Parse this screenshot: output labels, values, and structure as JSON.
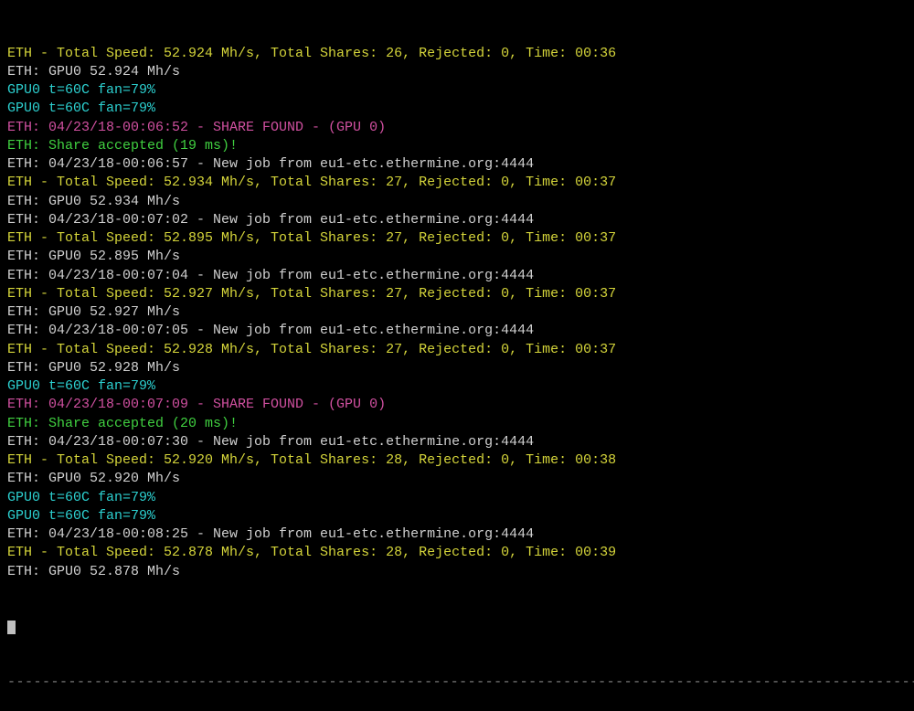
{
  "lines": [
    {
      "color": "yellow",
      "text": "ETH - Total Speed: 52.924 Mh/s, Total Shares: 26, Rejected: 0, Time: 00:36"
    },
    {
      "color": "white",
      "text": "ETH: GPU0 52.924 Mh/s"
    },
    {
      "color": "cyan",
      "text": "GPU0 t=60C fan=79%"
    },
    {
      "color": "cyan",
      "text": "GPU0 t=60C fan=79%"
    },
    {
      "color": "magenta",
      "text": "ETH: 04/23/18-00:06:52 - SHARE FOUND - (GPU 0)"
    },
    {
      "color": "green",
      "text": "ETH: Share accepted (19 ms)!"
    },
    {
      "color": "white",
      "text": "ETH: 04/23/18-00:06:57 - New job from eu1-etc.ethermine.org:4444"
    },
    {
      "color": "yellow",
      "text": "ETH - Total Speed: 52.934 Mh/s, Total Shares: 27, Rejected: 0, Time: 00:37"
    },
    {
      "color": "white",
      "text": "ETH: GPU0 52.934 Mh/s"
    },
    {
      "color": "white",
      "text": "ETH: 04/23/18-00:07:02 - New job from eu1-etc.ethermine.org:4444"
    },
    {
      "color": "yellow",
      "text": "ETH - Total Speed: 52.895 Mh/s, Total Shares: 27, Rejected: 0, Time: 00:37"
    },
    {
      "color": "white",
      "text": "ETH: GPU0 52.895 Mh/s"
    },
    {
      "color": "white",
      "text": "ETH: 04/23/18-00:07:04 - New job from eu1-etc.ethermine.org:4444"
    },
    {
      "color": "yellow",
      "text": "ETH - Total Speed: 52.927 Mh/s, Total Shares: 27, Rejected: 0, Time: 00:37"
    },
    {
      "color": "white",
      "text": "ETH: GPU0 52.927 Mh/s"
    },
    {
      "color": "white",
      "text": "ETH: 04/23/18-00:07:05 - New job from eu1-etc.ethermine.org:4444"
    },
    {
      "color": "yellow",
      "text": "ETH - Total Speed: 52.928 Mh/s, Total Shares: 27, Rejected: 0, Time: 00:37"
    },
    {
      "color": "white",
      "text": "ETH: GPU0 52.928 Mh/s"
    },
    {
      "color": "cyan",
      "text": "GPU0 t=60C fan=79%"
    },
    {
      "color": "magenta",
      "text": "ETH: 04/23/18-00:07:09 - SHARE FOUND - (GPU 0)"
    },
    {
      "color": "green",
      "text": "ETH: Share accepted (20 ms)!"
    },
    {
      "color": "white",
      "text": "ETH: 04/23/18-00:07:30 - New job from eu1-etc.ethermine.org:4444"
    },
    {
      "color": "yellow",
      "text": "ETH - Total Speed: 52.920 Mh/s, Total Shares: 28, Rejected: 0, Time: 00:38"
    },
    {
      "color": "white",
      "text": "ETH: GPU0 52.920 Mh/s"
    },
    {
      "color": "cyan",
      "text": "GPU0 t=60C fan=79%"
    },
    {
      "color": "cyan",
      "text": "GPU0 t=60C fan=79%"
    },
    {
      "color": "white",
      "text": "ETH: 04/23/18-00:08:25 - New job from eu1-etc.ethermine.org:4444"
    },
    {
      "color": "yellow",
      "text": "ETH - Total Speed: 52.878 Mh/s, Total Shares: 28, Rejected: 0, Time: 00:39"
    },
    {
      "color": "white",
      "text": "ETH: GPU0 52.878 Mh/s"
    }
  ],
  "separator": "--------------------------------------------------------------------------------------------------------------"
}
